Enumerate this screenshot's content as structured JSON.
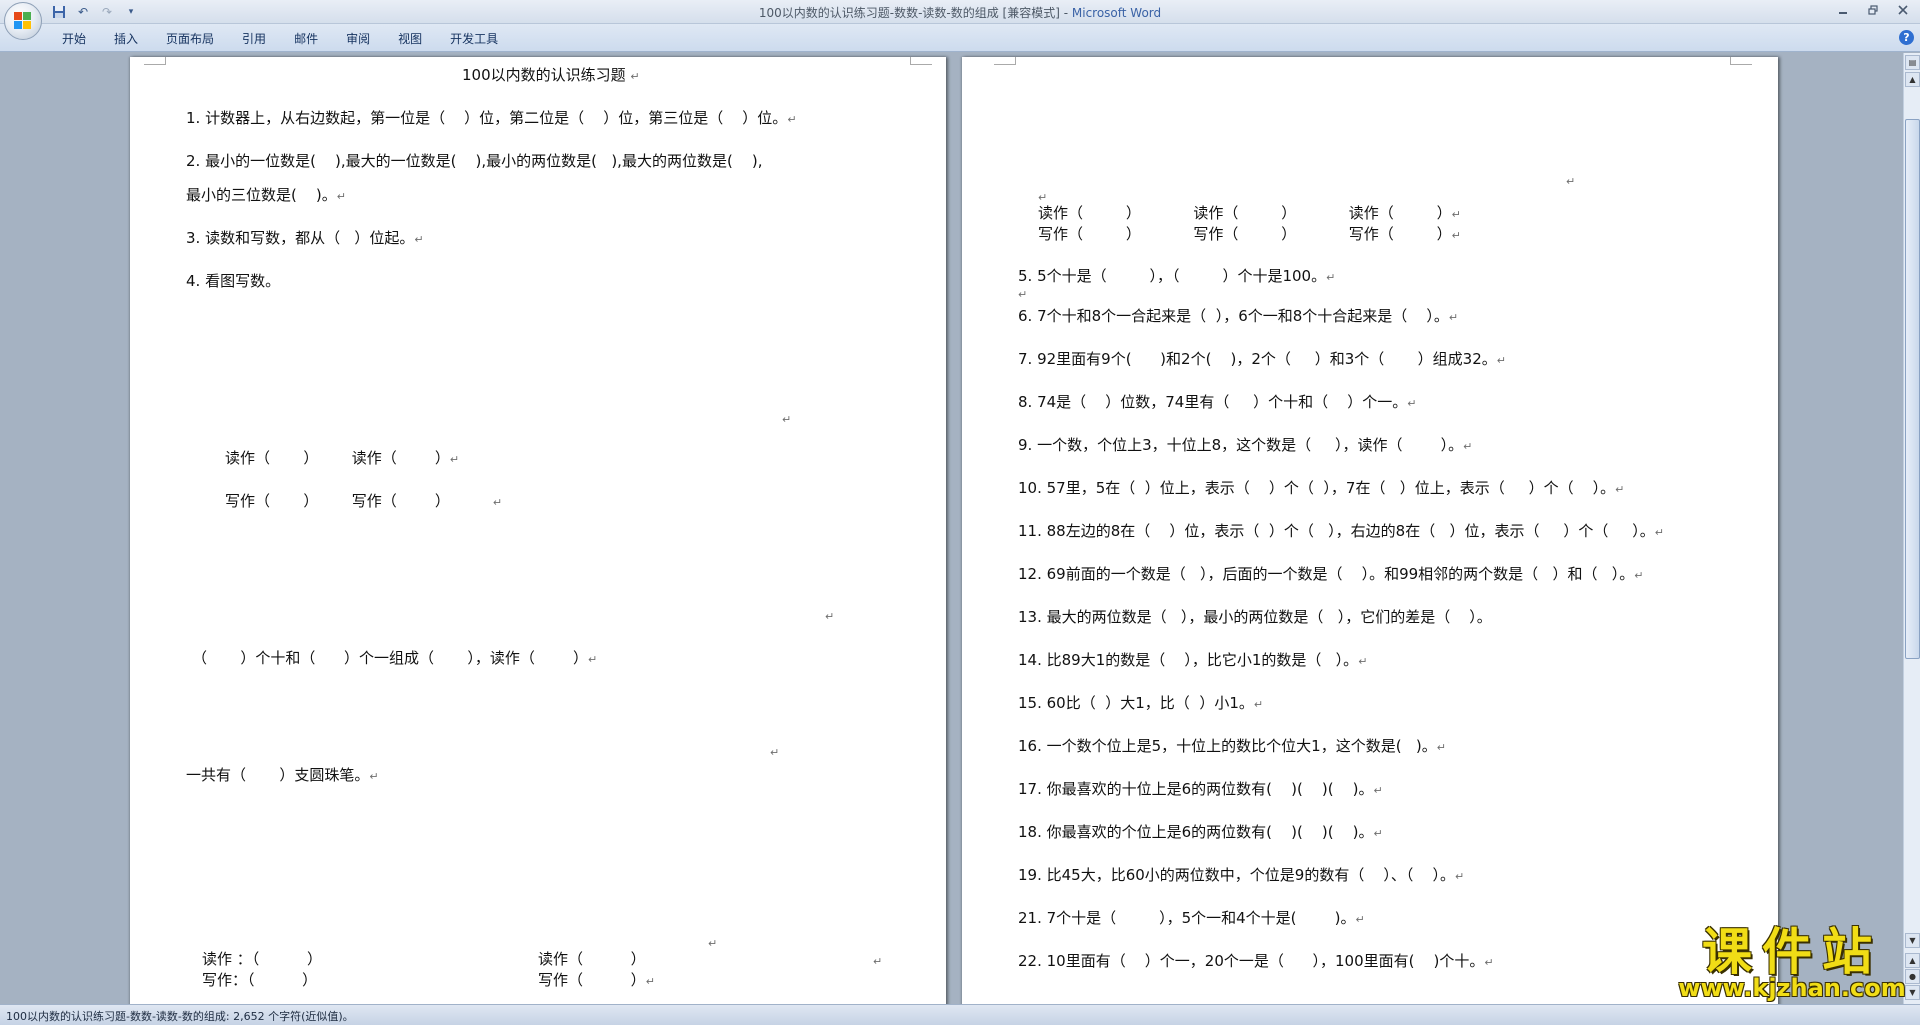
{
  "window": {
    "title": "100以内数的认识练习题-数数-读数-数的组成 [兼容模式] - ",
    "app_name": "Microsoft Word"
  },
  "qat": {
    "save_icon": "save-icon",
    "undo_label": "↶",
    "redo_label": "↷",
    "customize_label": "▾"
  },
  "ribbon": {
    "tabs": [
      "开始",
      "插入",
      "页面布局",
      "引用",
      "邮件",
      "审阅",
      "视图",
      "开发工具"
    ],
    "help_label": "?"
  },
  "page1": {
    "heading": "100以内数的认识练习题",
    "q1": "1. 计数器上，从右边数起，第一位是（    ）位，第二位是（    ）位，第三位是（    ）位。",
    "q2a": "2. 最小的一位数是(    ),最大的一位数是(    ),最小的两位数是(   ),最大的两位数是(    ),",
    "q2b": "最小的三位数是(    )。",
    "q3": "3. 读数和写数，都从（   ）位起。",
    "q4": "4. 看图写数。",
    "read_row": "读作（       ）       读作（        ）",
    "write_row": "写作（       ）       写作（        ）",
    "compose": "（       ）个十和（      ）个一组成（       ），读作（        ）",
    "total": "一共有（       ）支圆珠笔。",
    "read_bottom_a": "读作 ：（          ）",
    "read_bottom_b": "读作（          ）",
    "write_bottom_a": "写作：（          ）",
    "write_bottom_b": "写作（          ）"
  },
  "page2": {
    "read_row": "读作（         ）           读作（         ）           读作（         ）",
    "write_row": "写作（         ）           写作（         ）           写作（         ）",
    "questions": [
      "5. 5个十是（         ），（         ）个十是100。",
      "6. 7个十和8个一合起来是（  ），6个一和8个十合起来是（    ）。",
      "7. 92里面有9个(      )和2个(    )，2个（     ）和3个（       ）组成32。",
      "8. 74是（    ）位数，74里有（     ）个十和（    ）个一。",
      "9. 一个数，个位上3，十位上8，这个数是（     ），读作（        ）。",
      "10. 57里，5在（  ）位上，表示（    ）个（  ），7在（   ）位上，表示（     ）个（    ）。",
      "11. 88左边的8在（    ）位，表示（  ）个（   ），右边的8在（   ）位，表示（     ）个（     ）。",
      "12. 69前面的一个数是（   ），后面的一个数是（    ）。和99相邻的两个数是（   ）和（   ）。",
      "13. 最大的两位数是（   ），最小的两位数是（   ），它们的差是（    ）。",
      "14. 比89大1的数是（    ），比它小1的数是（   ）。",
      "15. 60比（  ）大1，比（  ）小1。",
      "16. 一个数个位上是5，十位上的数比个位大1，这个数是(   )。",
      "17. 你最喜欢的十位上是6的两位数有(    )(    )(    )。",
      "18. 你最喜欢的个位上是6的两位数有(    )(    )(    )。",
      "19. 比45大，比60小的两位数中，个位是9的数有（    ）、（    ）。",
      "21. 7个十是（         ），5个一和4个十是(        )。",
      "22. 10里面有（    ）个一，20个一是（      ），100里面有(    )个十。"
    ]
  },
  "status": {
    "text": "100以内数的认识练习题-数数-读数-数的组成: 2,652 个字符(近似值)。"
  },
  "watermark": {
    "title": "课件站",
    "url": "www.kjzhan.com"
  },
  "marks": {
    "para": "↵"
  }
}
